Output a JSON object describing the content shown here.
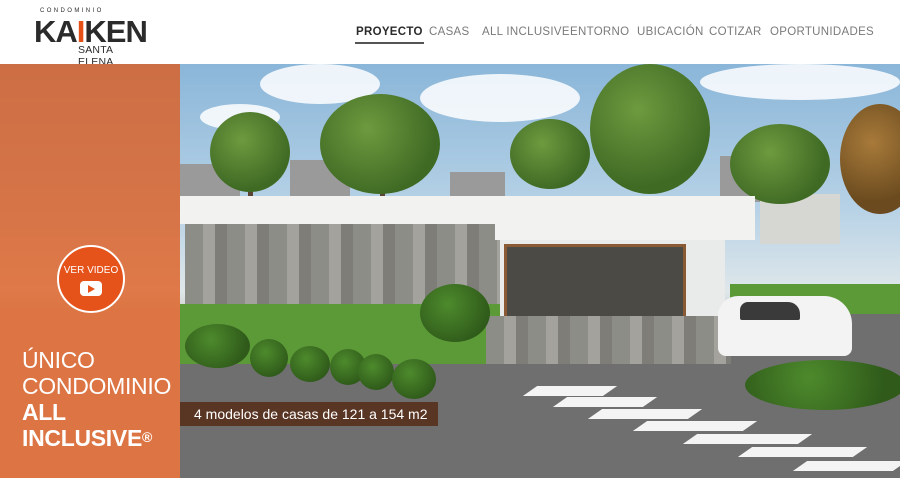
{
  "logo": {
    "top_text": "CONDOMINIO",
    "main_text": "KAIKEN",
    "sub_text": "SANTA ELENA",
    "accent_color": "#e45016"
  },
  "nav": {
    "items": [
      {
        "label": "PROYECTO",
        "active": true
      },
      {
        "label": "CASAS",
        "active": false
      },
      {
        "label": "ALL INCLUSIVE",
        "active": false
      },
      {
        "label": "ENTORNO",
        "active": false
      },
      {
        "label": "UBICACIÓN",
        "active": false
      },
      {
        "label": "COTIZAR",
        "active": false
      },
      {
        "label": "OPORTUNIDADES",
        "active": false
      }
    ]
  },
  "hero": {
    "video_button": {
      "label": "VER VIDEO",
      "icon": "youtube-play-icon"
    },
    "headline": {
      "line1": "ÚNICO",
      "line2": "CONDOMINIO",
      "line3": "ALL",
      "line4": "INCLUSIVE",
      "mark": "®"
    },
    "banner_text": "4 modelos de casas de 121 a 154 m2",
    "overlay_color": "#df5a1b"
  }
}
